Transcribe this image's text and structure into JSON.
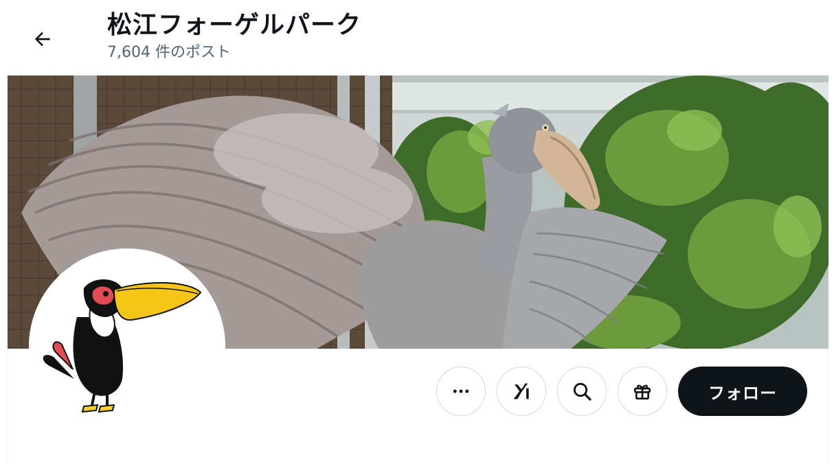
{
  "header": {
    "title": "松江フォーゲルパーク",
    "post_count": "7,604 件のポスト"
  },
  "banner": {
    "subject": "shoebill-with-spread-wings-photo"
  },
  "avatar": {
    "subject": "toucan-illustration"
  },
  "actions": {
    "more_icon": "more-horizontal-icon",
    "grok_icon": "grok-icon",
    "search_icon": "search-icon",
    "gift_icon": "gift-icon",
    "follow_label": "フォロー"
  },
  "colors": {
    "follow_bg": "#0f1419",
    "follow_text": "#ffffff",
    "border": "#cfd9de",
    "secondary_text": "#536471"
  }
}
